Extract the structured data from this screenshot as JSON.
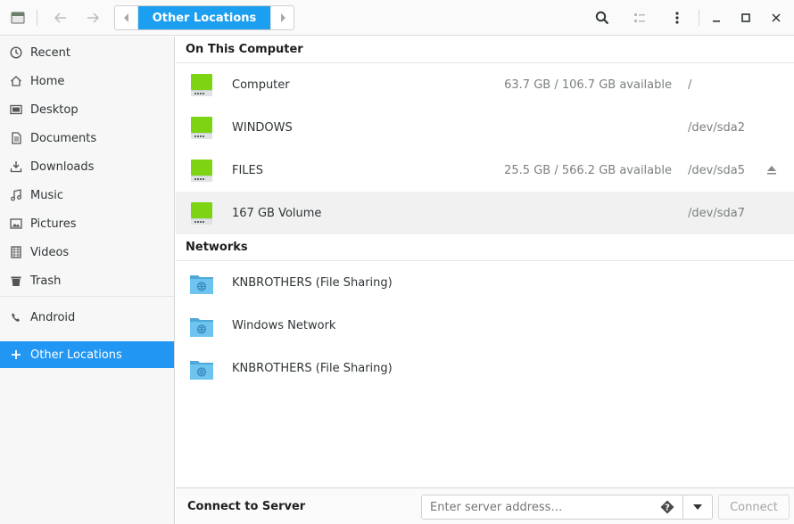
{
  "header": {
    "breadcrumb": "Other Locations"
  },
  "sidebar": {
    "items": [
      {
        "label": "Recent",
        "icon": "clock-icon"
      },
      {
        "label": "Home",
        "icon": "home-icon"
      },
      {
        "label": "Desktop",
        "icon": "desktop-icon"
      },
      {
        "label": "Documents",
        "icon": "document-icon"
      },
      {
        "label": "Downloads",
        "icon": "download-icon"
      },
      {
        "label": "Music",
        "icon": "music-icon"
      },
      {
        "label": "Pictures",
        "icon": "picture-icon"
      },
      {
        "label": "Videos",
        "icon": "video-icon"
      },
      {
        "label": "Trash",
        "icon": "trash-icon"
      },
      {
        "label": "Android",
        "icon": "phone-icon"
      },
      {
        "label": "Other Locations",
        "icon": "plus-icon"
      }
    ]
  },
  "main": {
    "computer_title": "On This Computer",
    "drives": [
      {
        "name": "Computer",
        "available": "63.7 GB / 106.7 GB available",
        "device": "/"
      },
      {
        "name": "WINDOWS",
        "available": "",
        "device": "/dev/sda2"
      },
      {
        "name": "FILES",
        "available": "25.5 GB / 566.2 GB available",
        "device": "/dev/sda5"
      },
      {
        "name": "167 GB Volume",
        "available": "",
        "device": "/dev/sda7"
      }
    ],
    "networks_title": "Networks",
    "networks": [
      {
        "name": "KNBROTHERS (File Sharing)"
      },
      {
        "name": "Windows Network"
      },
      {
        "name": "KNBROTHERS (File Sharing)"
      }
    ]
  },
  "footer": {
    "title": "Connect to Server",
    "placeholder": "Enter server address…",
    "connect_label": "Connect"
  },
  "colors": {
    "accent": "#2196f3",
    "drive_green": "#7cd412",
    "folder_blue": "#6cc4ef"
  }
}
